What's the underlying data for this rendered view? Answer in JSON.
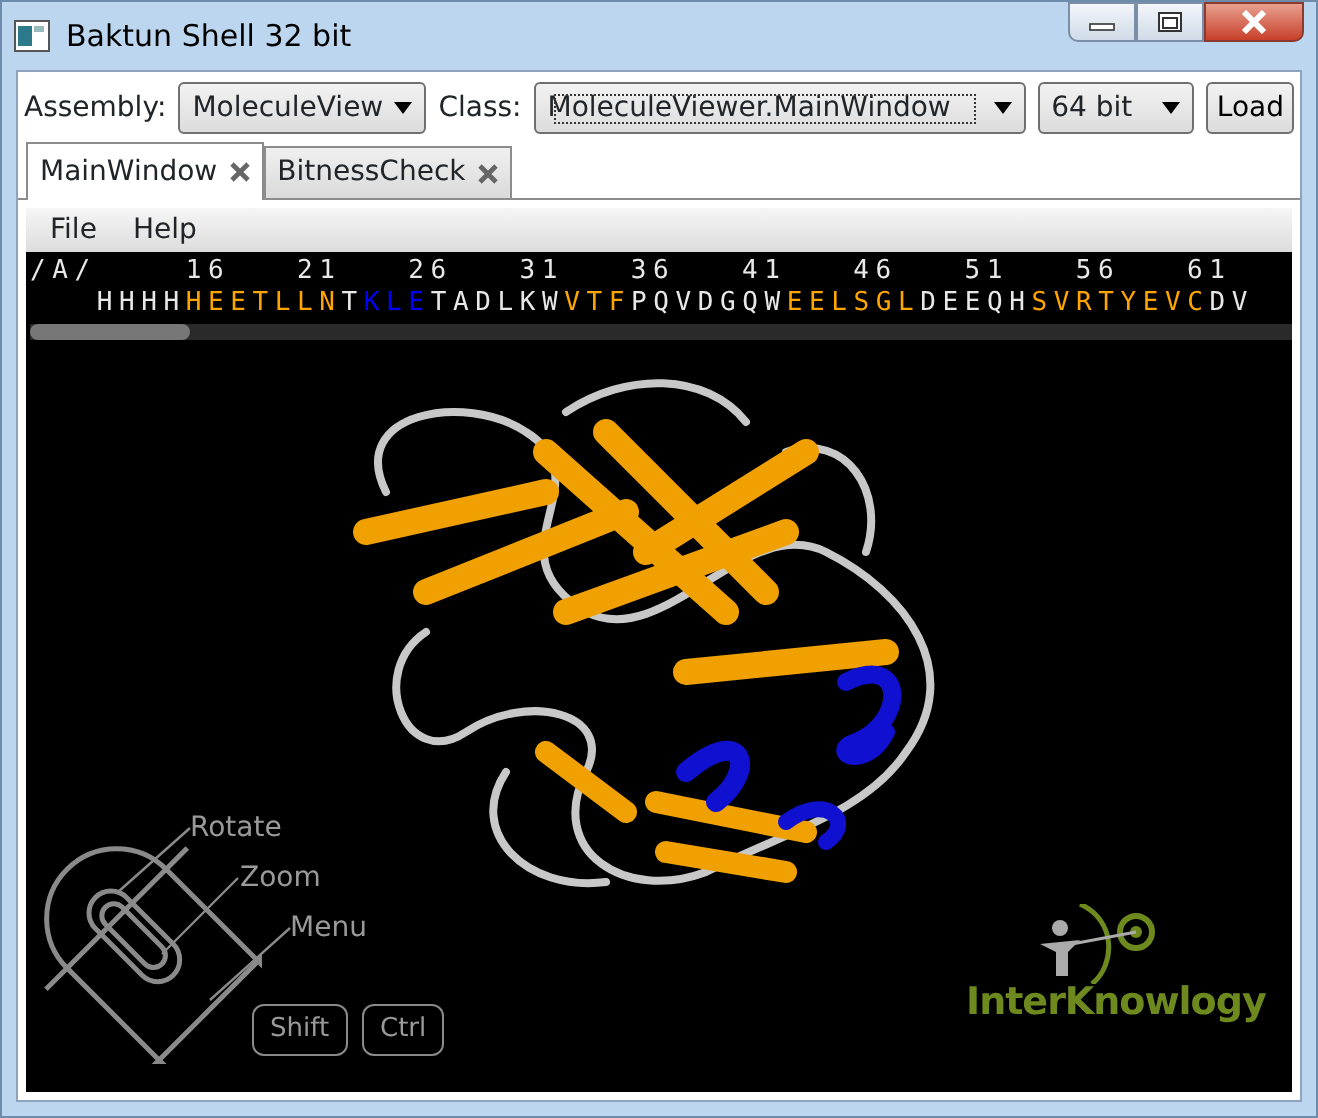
{
  "window": {
    "title": "Baktun Shell 32 bit"
  },
  "toolbar": {
    "assembly_label": "Assembly:",
    "assembly_value": "MoleculeView",
    "class_label": "Class:",
    "class_value": "MoleculeViewer.MainWindow",
    "bitness_value": "64 bit",
    "load_button": "Load"
  },
  "tabs": [
    {
      "label": "MainWindow",
      "selected": true
    },
    {
      "label": "BitnessCheck",
      "selected": false
    }
  ],
  "menu": [
    "File",
    "Help"
  ],
  "sequence": {
    "chain": "/A/",
    "ruler": [
      "16",
      "21",
      "26",
      "31",
      "36",
      "41",
      "46",
      "51",
      "56",
      "61"
    ],
    "segments": [
      {
        "text": "HHHH",
        "color": "#e8e8e8"
      },
      {
        "text": "HEETLLN",
        "color": "#ffa500"
      },
      {
        "text": "T",
        "color": "#e8e8e8"
      },
      {
        "text": "KLE",
        "color": "#0000ff"
      },
      {
        "text": "TADLKW",
        "color": "#e8e8e8"
      },
      {
        "text": "VTF",
        "color": "#ffa500"
      },
      {
        "text": "PQVDGQW",
        "color": "#e8e8e8"
      },
      {
        "text": "EELSGL",
        "color": "#ffa500"
      },
      {
        "text": "DEEQH",
        "color": "#e8e8e8"
      },
      {
        "text": "SVRTYEVC",
        "color": "#ffa500"
      },
      {
        "text": "DV",
        "color": "#e8e8e8"
      }
    ]
  },
  "viewer": {
    "mouse_labels": [
      "Rotate",
      "Zoom",
      "Menu"
    ],
    "keys": [
      "Shift",
      "Ctrl"
    ],
    "logo": "InterKnowlogy"
  }
}
